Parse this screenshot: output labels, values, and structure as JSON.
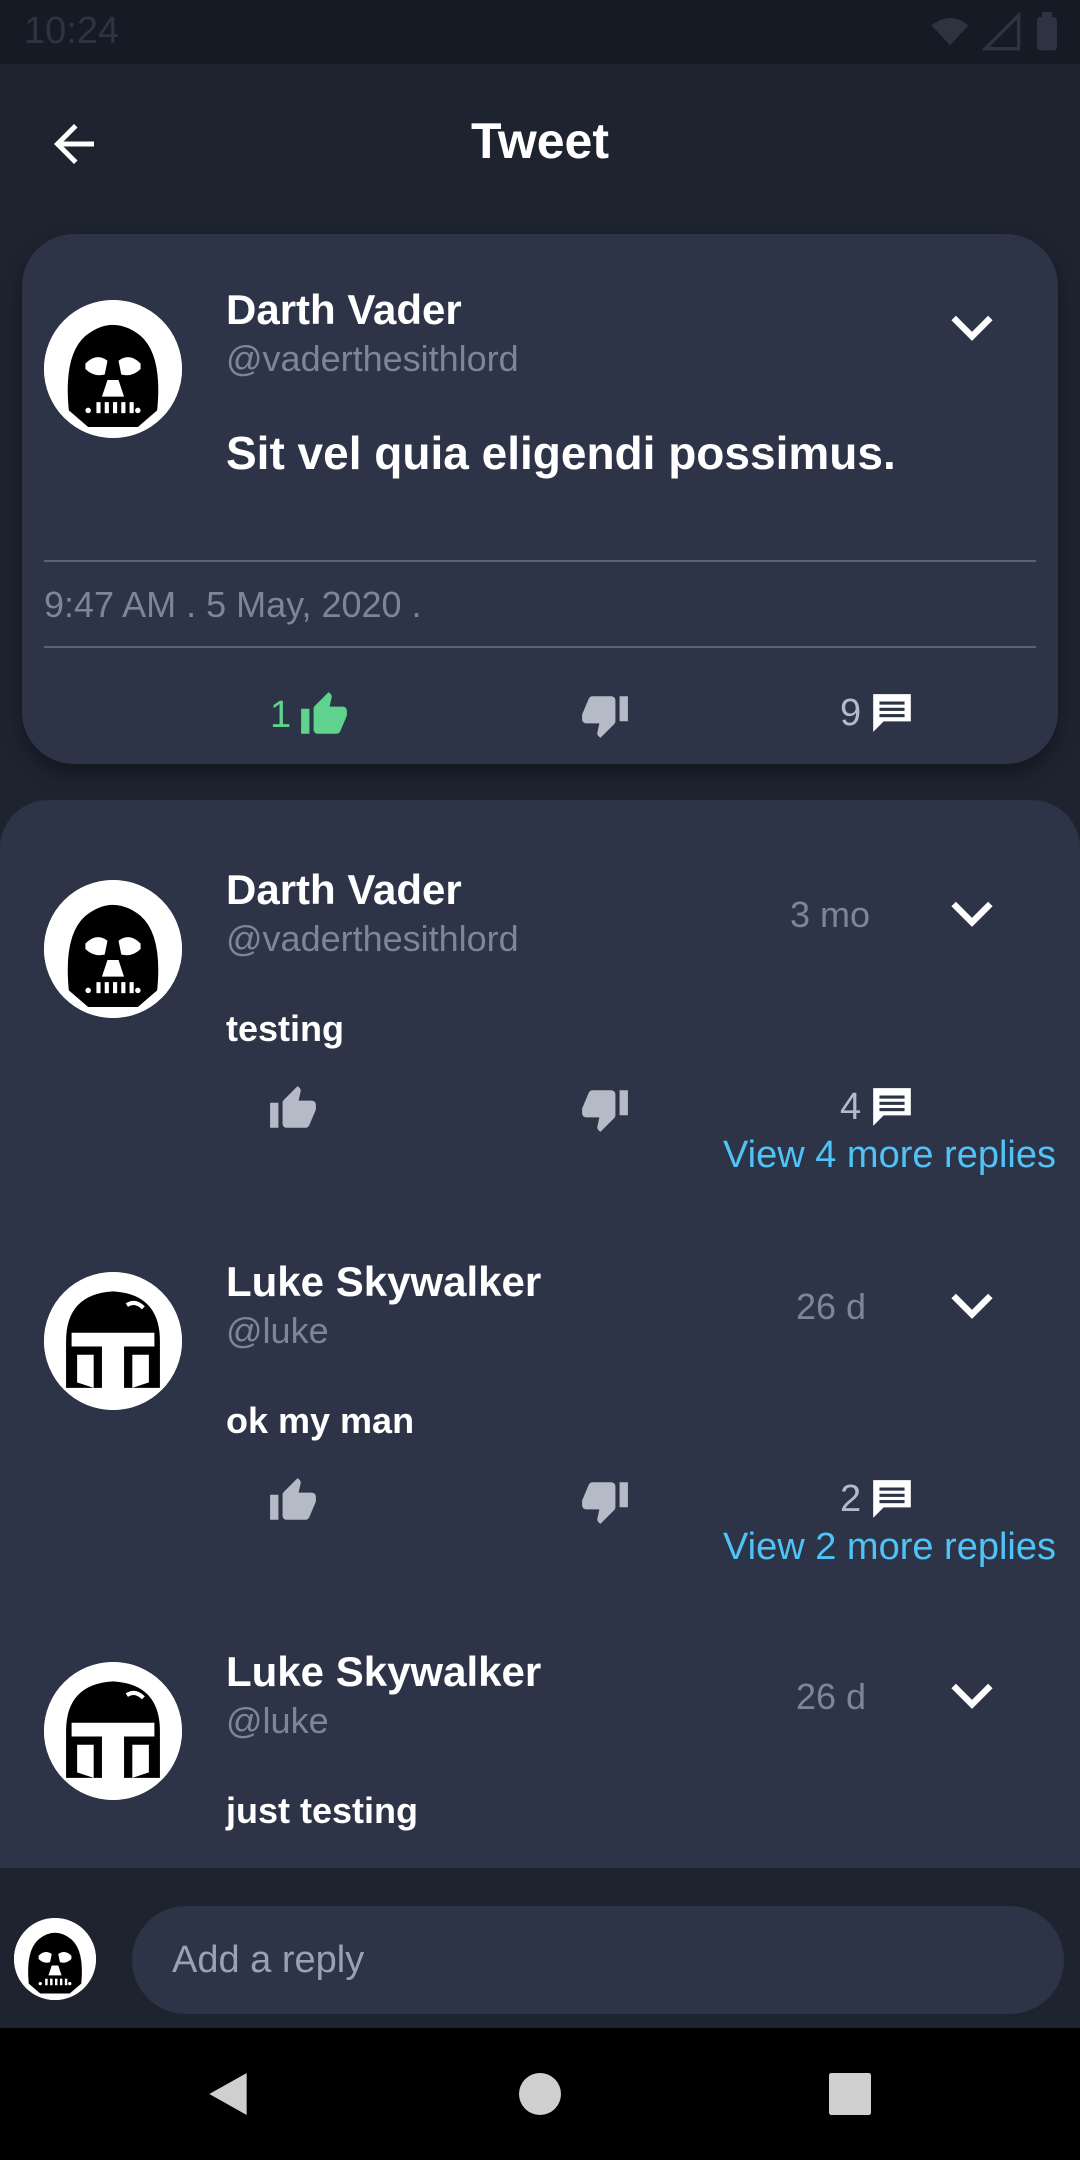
{
  "status_bar": {
    "time": "10:24"
  },
  "app_bar": {
    "title": "Tweet"
  },
  "tweet": {
    "author": "Darth Vader",
    "handle": "@vaderthesithlord",
    "text": "Sit vel quia eligendi possimus.",
    "timestamp": "9:47 AM . 5 May, 2020 .",
    "likes": "1",
    "comments": "9",
    "like_color": "#5fd38d"
  },
  "replies": [
    {
      "author": "Darth Vader",
      "handle": "@vaderthesithlord",
      "time_ago": "3 mo",
      "text": "testing",
      "comments": "4",
      "view_more": "View 4 more replies",
      "avatar": "vader-helmet"
    },
    {
      "author": "Luke Skywalker",
      "handle": "@luke",
      "time_ago": "26 d",
      "text": "ok my man",
      "comments": "2",
      "view_more": "View 2 more replies",
      "avatar": "mandalorian-helmet"
    },
    {
      "author": "Luke Skywalker",
      "handle": "@luke",
      "time_ago": "26 d",
      "text": "just testing",
      "avatar": "mandalorian-helmet"
    }
  ],
  "composer": {
    "placeholder": "Add a reply"
  },
  "colors": {
    "background": "#1e2330",
    "card": "#2e3447",
    "link": "#4fc3f7",
    "muted": "#7d8598"
  }
}
